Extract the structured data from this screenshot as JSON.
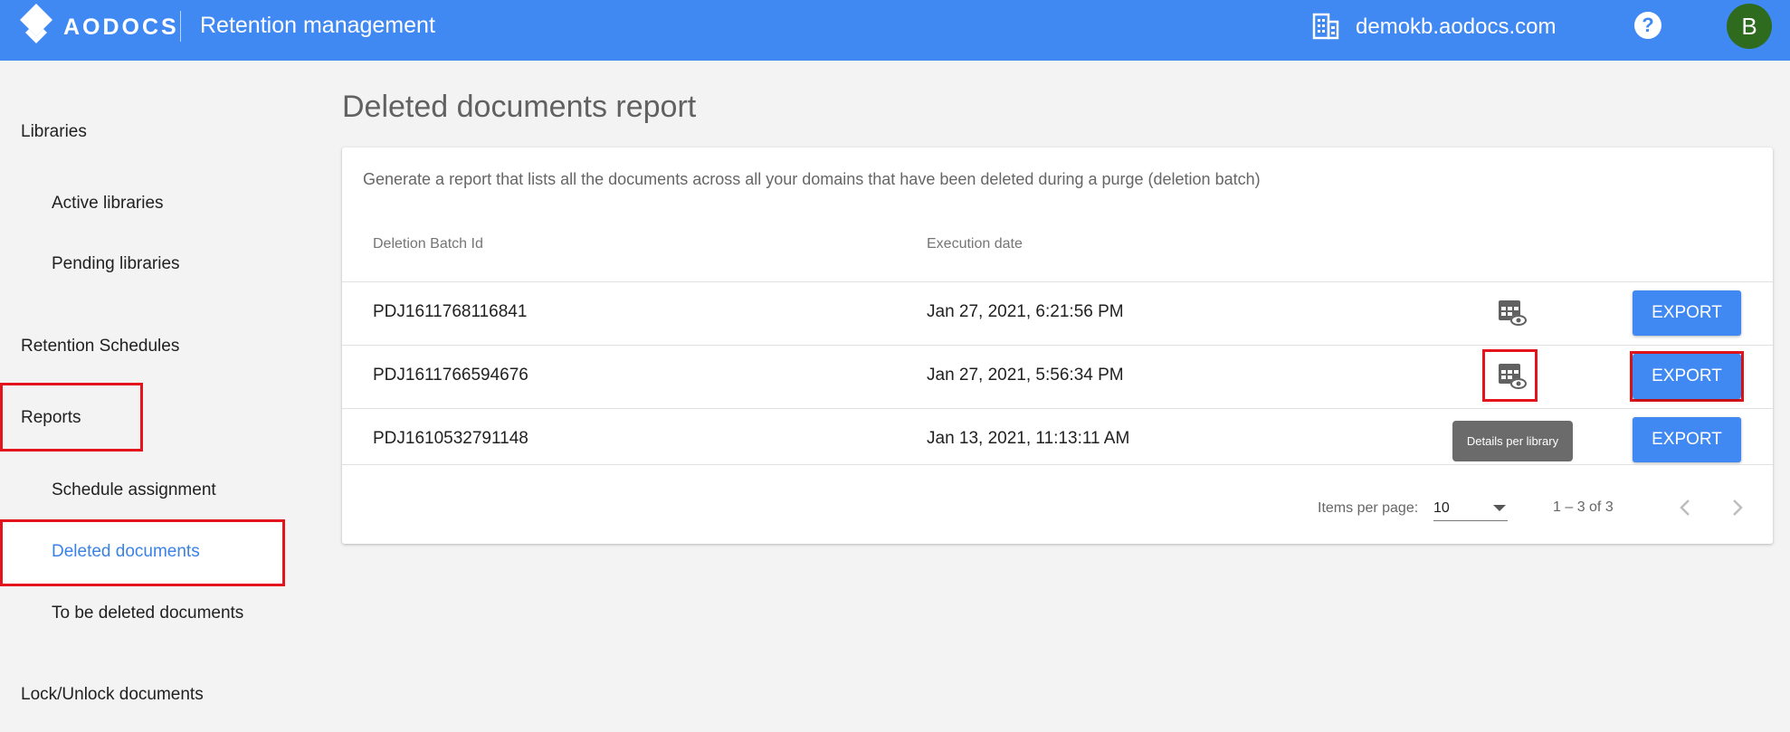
{
  "header": {
    "brand": "AODOCS",
    "app_title": "Retention management",
    "domain": "demokb.aodocs.com",
    "help_symbol": "?",
    "avatar_letter": "B",
    "colors": {
      "bar": "#4189f2",
      "avatar": "#2e6b1e"
    },
    "icons": [
      "aodocs-logo-icon",
      "domain-building-icon",
      "help-icon"
    ]
  },
  "sidebar": {
    "libraries": "Libraries",
    "active_libraries": "Active libraries",
    "pending_libraries": "Pending libraries",
    "retention_schedules": "Retention Schedules",
    "reports": "Reports",
    "schedule_assignment": "Schedule assignment",
    "deleted_documents": "Deleted documents",
    "to_be_deleted_documents": "To be deleted documents",
    "lock_unlock_documents": "Lock/Unlock documents",
    "active_item": "Deleted documents",
    "active_color": "#3b82e6"
  },
  "main": {
    "title": "Deleted documents report",
    "description": "Generate a report that lists all the documents across all your domains that have been deleted during a purge (deletion batch)",
    "columns": {
      "batch_id": "Deletion Batch Id",
      "execution_date": "Execution date"
    },
    "rows": [
      {
        "batch_id": "PDJ1611768116841",
        "execution_date": "Jan 27, 2021, 6:21:56 PM",
        "action": "EXPORT"
      },
      {
        "batch_id": "PDJ1611766594676",
        "execution_date": "Jan 27, 2021, 5:56:34 PM",
        "action": "EXPORT"
      },
      {
        "batch_id": "PDJ1610532791148",
        "execution_date": "Jan 13, 2021, 11:13:11 AM",
        "action": "EXPORT"
      }
    ],
    "details_icon": "table-eye-icon",
    "tooltip": "Details per library",
    "highlight_color": "#e3141b",
    "paginator": {
      "items_per_page_label": "Items per page:",
      "items_per_page_value": "10",
      "range": "1 – 3 of 3",
      "icons": [
        "chevron-left-icon",
        "chevron-right-icon"
      ]
    }
  }
}
